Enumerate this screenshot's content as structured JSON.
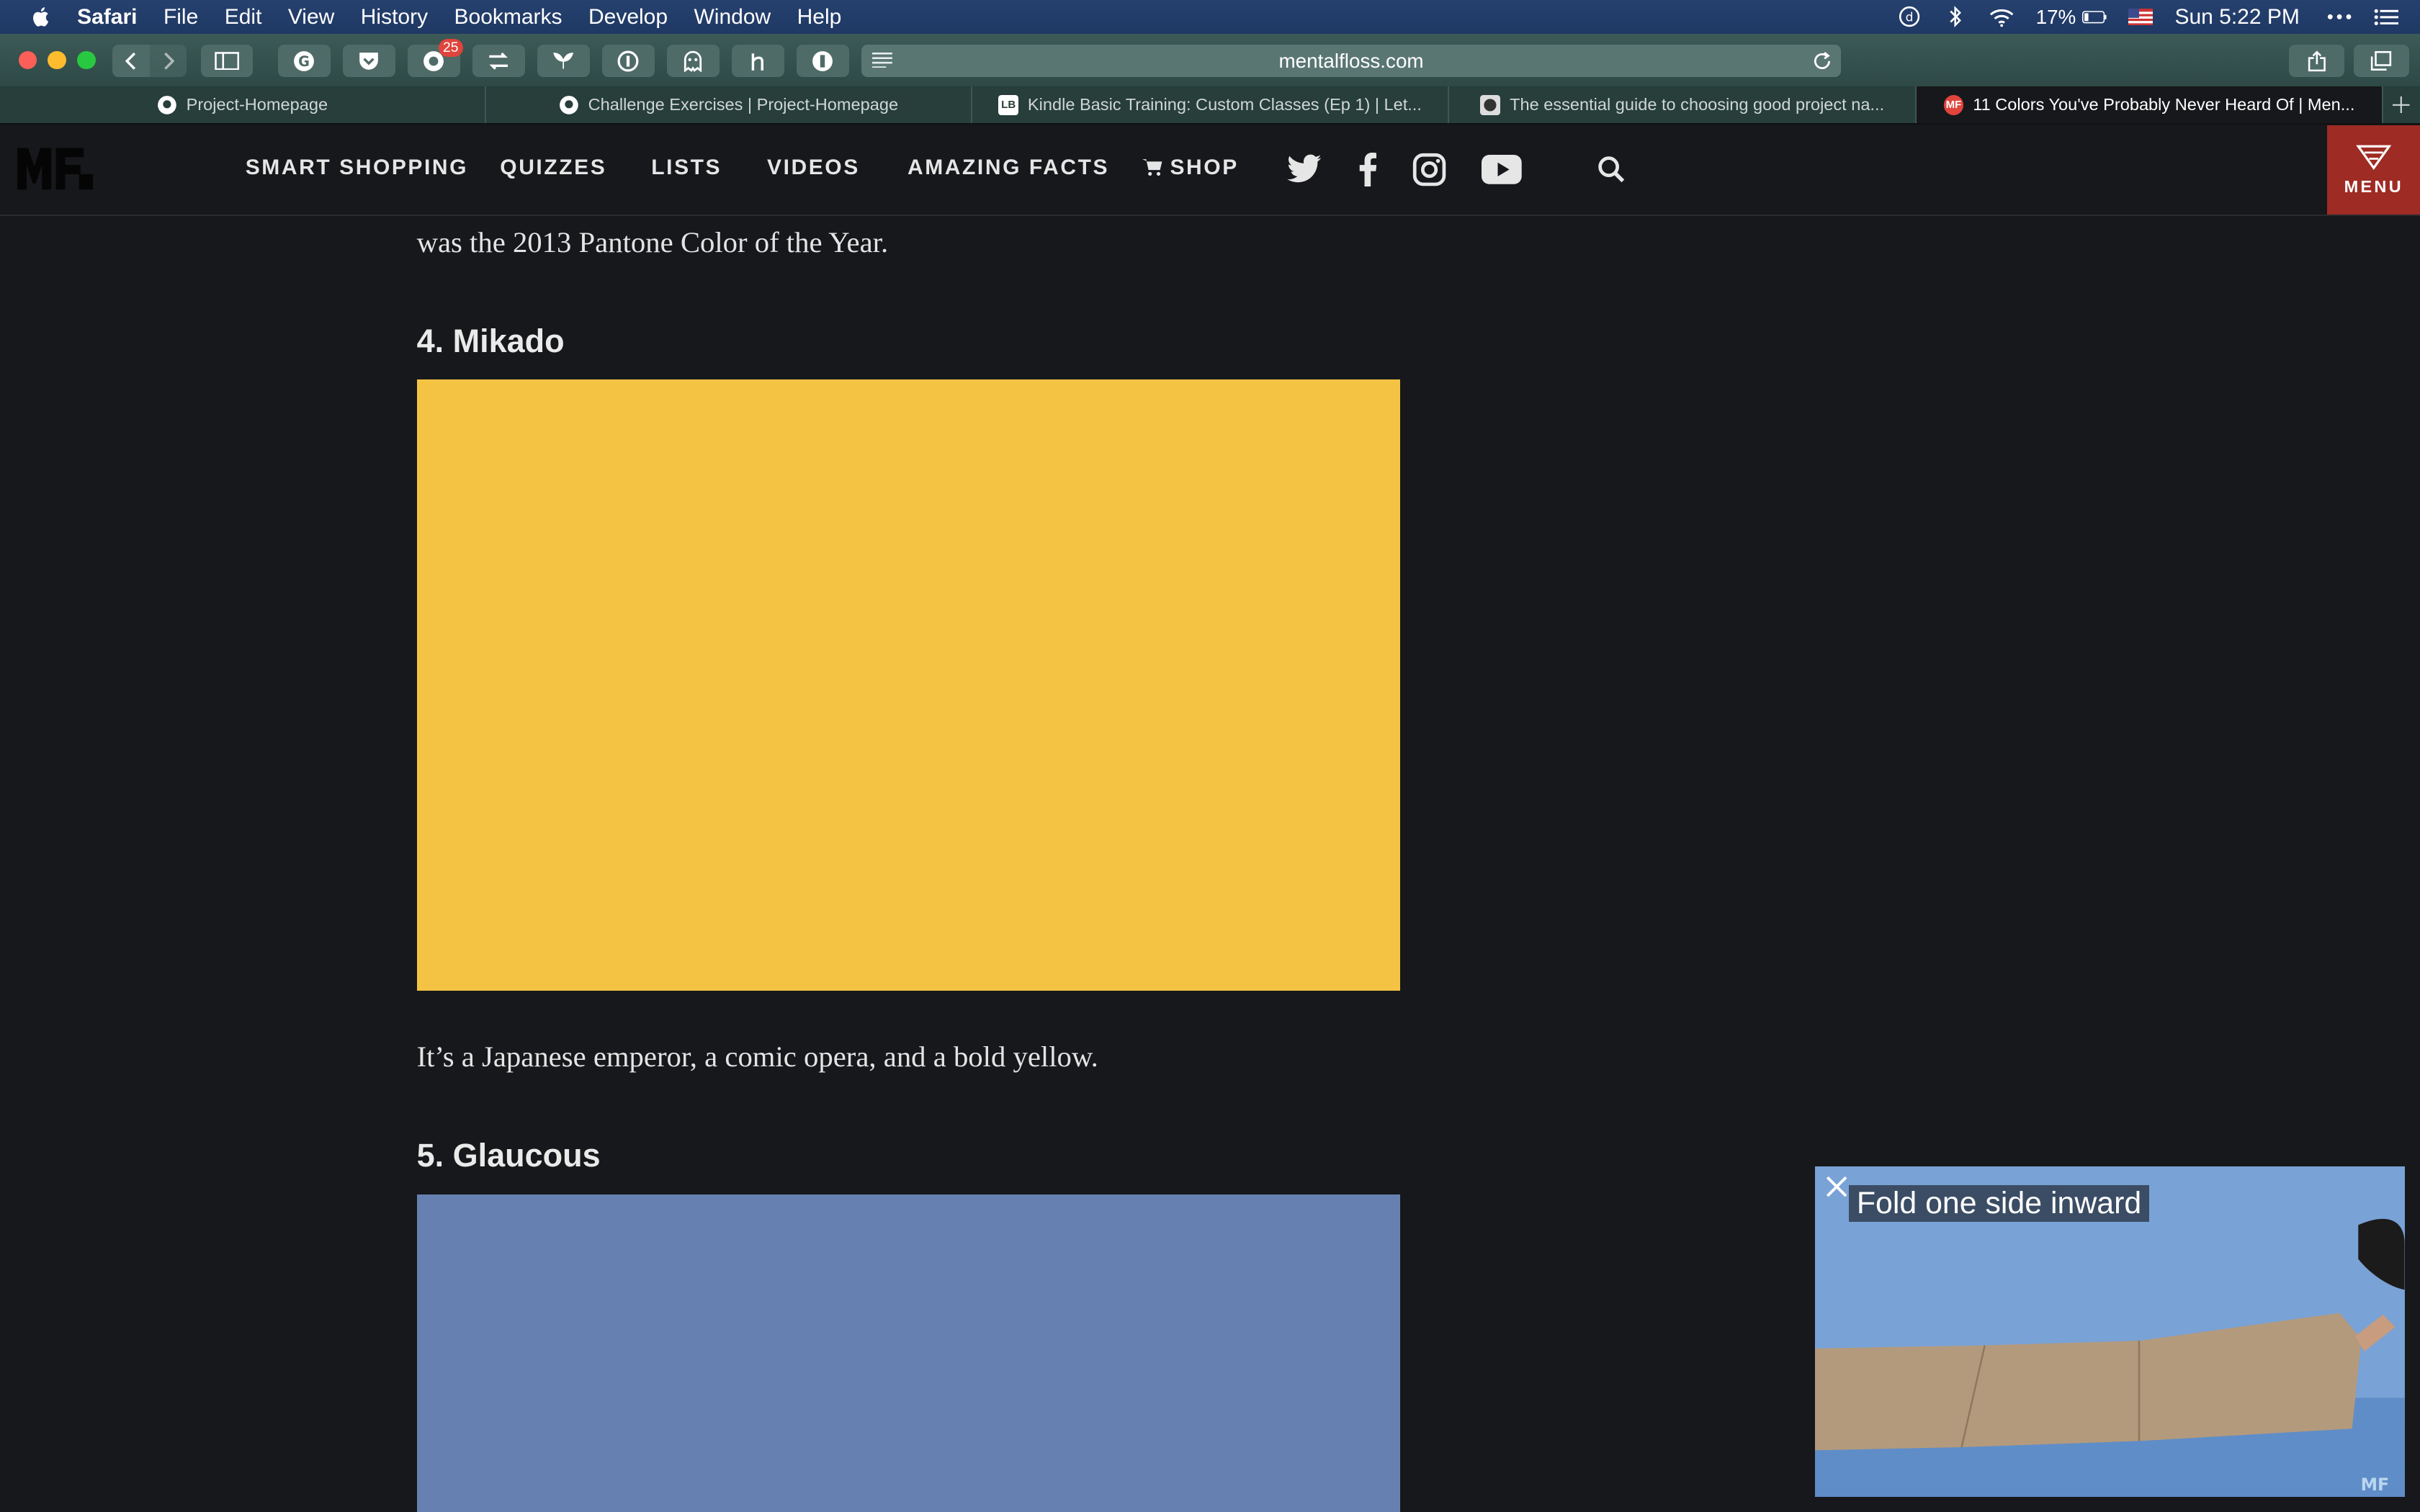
{
  "menubar": {
    "app": "Safari",
    "items": [
      "File",
      "Edit",
      "View",
      "History",
      "Bookmarks",
      "Develop",
      "Window",
      "Help"
    ],
    "battery": "17%",
    "clock": "Sun 5:22 PM"
  },
  "toolbar": {
    "url": "mentalfloss.com",
    "badge_count": "25"
  },
  "tabs": [
    {
      "label": "Project-Homepage",
      "icon": "github-icon"
    },
    {
      "label": "Challenge Exercises | Project-Homepage",
      "icon": "github-icon"
    },
    {
      "label": "Kindle Basic Training: Custom Classes (Ep 1) | Let...",
      "icon": "lb-icon",
      "icon_text": "LB"
    },
    {
      "label": "The essential guide to choosing good project na...",
      "icon": "site-icon"
    },
    {
      "label": "11 Colors You've Probably Never Heard Of | Men...",
      "icon": "mf-icon",
      "icon_text": "MF",
      "active": true
    }
  ],
  "site": {
    "nav": [
      "SMART SHOPPING",
      "QUIZZES",
      "LISTS",
      "VIDEOS",
      "AMAZING FACTS",
      "SHOP"
    ],
    "menu_label": "MENU"
  },
  "article": {
    "para1": "was the 2013 Pantone Color of the Year.",
    "h4": "4. Mikado",
    "swatch4_color": "#f5c344",
    "para2": "It’s a Japanese emperor, a comic opera, and a bold yellow.",
    "h5": "5. Glaucous",
    "swatch5_color": "#6681b1"
  },
  "video": {
    "caption": "Fold one side inward",
    "watermark": "MF"
  }
}
